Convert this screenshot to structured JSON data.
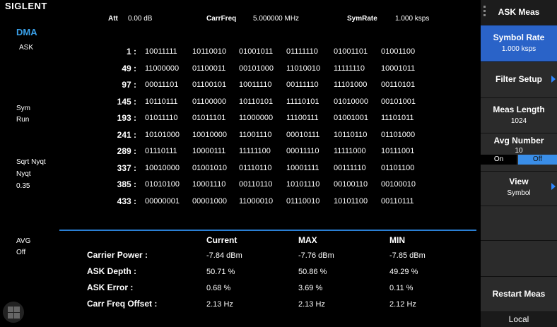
{
  "brand": "SIGLENT",
  "header": {
    "att_label": "Att",
    "att_value": "0.00 dB",
    "carrfreq_label": "CarrFreq",
    "carrfreq_value": "5.000000 MHz",
    "symrate_label": "SymRate",
    "symrate_value": "1.000 ksps"
  },
  "left": {
    "mode": "DMA",
    "modulation": "ASK",
    "sym": "Sym",
    "run": "Run",
    "filter": "Sqrt Nyqt",
    "filter2": "Nyqt",
    "alpha": "0.35",
    "avg": "AVG",
    "avg_state": "Off"
  },
  "symbols": [
    {
      "idx": "1 :",
      "bits": [
        "10011111",
        "10110010",
        "01001011",
        "01111110",
        "01001101",
        "01001100"
      ]
    },
    {
      "idx": "49 :",
      "bits": [
        "11000000",
        "01100011",
        "00101000",
        "11010010",
        "11111110",
        "10001011"
      ]
    },
    {
      "idx": "97 :",
      "bits": [
        "00011101",
        "01100101",
        "10011110",
        "00111110",
        "11101000",
        "00110101"
      ]
    },
    {
      "idx": "145 :",
      "bits": [
        "10110111",
        "01100000",
        "10110101",
        "11110101",
        "01010000",
        "00101001"
      ]
    },
    {
      "idx": "193 :",
      "bits": [
        "01011110",
        "01011101",
        "11000000",
        "11100111",
        "01001001",
        "11101011"
      ]
    },
    {
      "idx": "241 :",
      "bits": [
        "10101000",
        "10010000",
        "11001110",
        "00010111",
        "10110110",
        "01101000"
      ]
    },
    {
      "idx": "289 :",
      "bits": [
        "01110111",
        "10000111",
        "11111100",
        "00011110",
        "11111000",
        "10111001"
      ]
    },
    {
      "idx": "337 :",
      "bits": [
        "10010000",
        "01001010",
        "01110110",
        "10001111",
        "00111110",
        "01101100"
      ]
    },
    {
      "idx": "385 :",
      "bits": [
        "01010100",
        "10001110",
        "00110110",
        "10101110",
        "00100110",
        "00100010"
      ]
    },
    {
      "idx": "433 :",
      "bits": [
        "00000001",
        "00001000",
        "11000010",
        "01110010",
        "10101100",
        "00110111"
      ]
    }
  ],
  "metrics": {
    "headers": [
      "Current",
      "MAX",
      "MIN"
    ],
    "rows": [
      {
        "label": "Carrier Power :",
        "values": [
          "-7.84 dBm",
          "-7.76 dBm",
          "-7.85 dBm"
        ]
      },
      {
        "label": "ASK Depth :",
        "values": [
          "50.71 %",
          "50.86 %",
          "49.29 %"
        ]
      },
      {
        "label": "ASK Error :",
        "values": [
          "0.68 %",
          "3.69 %",
          "0.11 %"
        ]
      },
      {
        "label": "Carr Freq Offset :",
        "values": [
          "2.13 Hz",
          "2.13 Hz",
          "2.12 Hz"
        ]
      }
    ]
  },
  "menu": {
    "title": "ASK Meas",
    "symbol_rate_label": "Symbol Rate",
    "symbol_rate_value": "1.000 ksps",
    "filter_setup": "Filter Setup",
    "meas_length_label": "Meas Length",
    "meas_length_value": "1024",
    "avg_number_label": "Avg Number",
    "avg_number_value": "10",
    "avg_on": "On",
    "avg_off": "Off",
    "view_label": "View",
    "view_value": "Symbol",
    "restart": "Restart Meas",
    "local": "Local"
  },
  "colors": {
    "accent": "#2a63c8",
    "mode_text": "#3aa0e8",
    "divider": "#2a7fd4"
  }
}
